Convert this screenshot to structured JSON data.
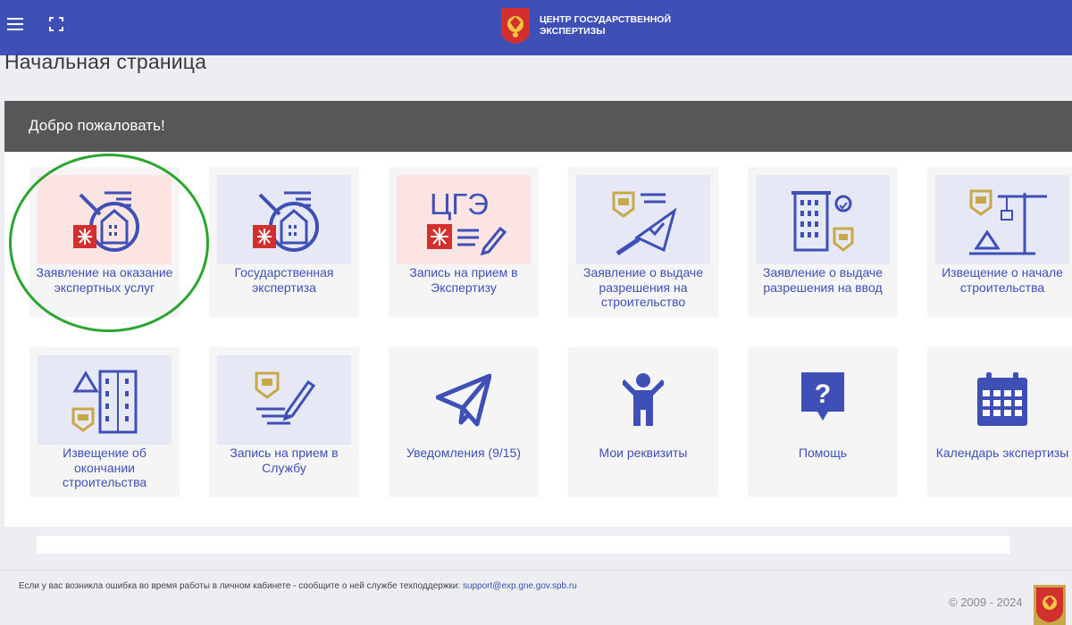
{
  "header": {
    "brand_line1": "ЦЕНТР ГОСУДАРСТВЕННОЙ",
    "brand_line2": "ЭКСПЕРТИЗЫ",
    "bg_color": "#3e4fb5"
  },
  "page_title": "Начальная страница",
  "panel": {
    "header": "Добро пожаловать!",
    "tiles": [
      {
        "label": "Заявление на оказание экспертных услуг",
        "icon": "magnifier-building-icon"
      },
      {
        "label": "Государственная экспертиза",
        "icon": "magnifier-building-icon"
      },
      {
        "label": "Запись на прием в Экспертизу",
        "icon": "cge-logo-icon",
        "logo_text": "ЦГЭ"
      },
      {
        "label": "Заявление о выдаче разрешения на строительство",
        "icon": "trowel-icon"
      },
      {
        "label": "Заявление о выдаче разрешения на ввод",
        "icon": "building-badge-icon"
      },
      {
        "label": "Извещение о начале строительства",
        "icon": "crane-icon"
      },
      {
        "label": "Извещение об окончании строительства",
        "icon": "finished-building-icon"
      },
      {
        "label": "Запись на прием в Службу",
        "icon": "sign-pen-icon"
      },
      {
        "label": "Уведомления (9/15)",
        "icon": "paper-plane-icon"
      },
      {
        "label": "Мои реквизиты",
        "icon": "person-icon"
      },
      {
        "label": "Помощь",
        "icon": "help-icon",
        "glyph": "?"
      },
      {
        "label": "Календарь экспертизы",
        "icon": "calendar-icon"
      }
    ]
  },
  "footer": {
    "message": "Если у вас возникла ошибка во время работы в личном кабинете - сообщите о ней службе техподдержки:",
    "email": "support@exp.gne.gov.spb.ru",
    "copyright": "© 2009 - 2024"
  },
  "colors": {
    "accent": "#3e4fb5",
    "tile_pink": "#fce4e3",
    "tile_blue": "#e6e8f6",
    "highlight": "#2aa52e",
    "emblem_red": "#d32f2f"
  }
}
